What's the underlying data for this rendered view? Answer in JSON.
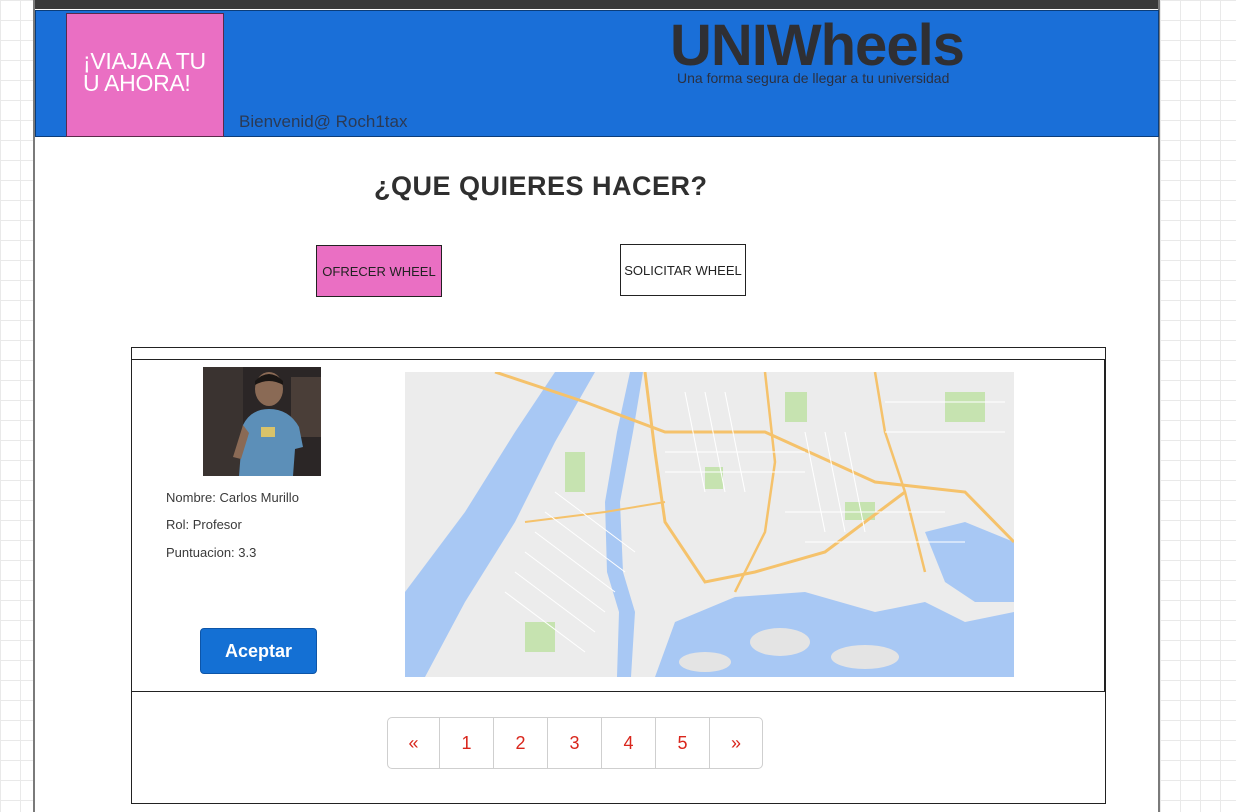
{
  "header": {
    "promo_text": "¡VIAJA A TU U AHORA!",
    "welcome_text": "Bienvenid@ Roch1tax",
    "brand_title": "UNIWheels",
    "brand_subtitle": "Una forma segura de llegar a tu universidad",
    "colors": {
      "header_bg": "#1a6fd8",
      "promo_bg": "#ea6fc3"
    }
  },
  "main": {
    "question": "¿QUE QUIERES HACER?",
    "offer_button": "OFRECER WHEEL",
    "request_button": "SOLICITAR WHEEL"
  },
  "card": {
    "name": "Nombre: Carlos Murillo",
    "role": "Rol: Profesor",
    "score": "Puntuacion: 3.3",
    "accept_button": "Aceptar",
    "map_icon": "map-image"
  },
  "pagination": {
    "prev": "«",
    "pages": [
      "1",
      "2",
      "3",
      "4",
      "5"
    ],
    "next": "»"
  }
}
